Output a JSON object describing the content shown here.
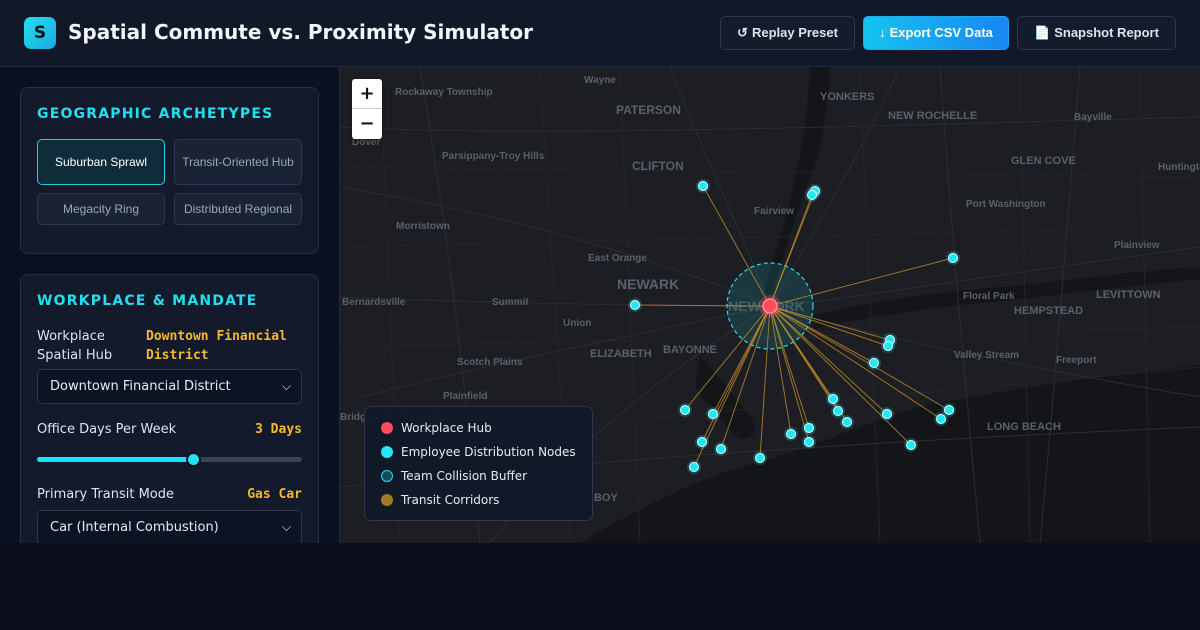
{
  "header": {
    "logo_letter": "S",
    "title": "Spatial Commute vs. Proximity Simulator",
    "replay_icon": "↺",
    "replay_label": "Replay Preset",
    "export_icon": "↓",
    "export_label": "Export CSV Data",
    "snapshot_icon": "📄",
    "snapshot_label": "Snapshot Report"
  },
  "archetypes": {
    "title": "GEOGRAPHIC ARCHETYPES",
    "items": [
      {
        "label": "Suburban Sprawl",
        "active": true
      },
      {
        "label": "Transit-Oriented Hub",
        "active": false
      },
      {
        "label": "Megacity Ring",
        "active": false
      },
      {
        "label": "Distributed Regional",
        "active": false
      }
    ]
  },
  "workplace": {
    "title": "WORKPLACE & MANDATE",
    "hub_label": "Workplace Spatial Hub",
    "hub_value": "Downtown Financial District",
    "hub_select": "Downtown Financial District",
    "days_label": "Office Days Per Week",
    "days_value": "3 Days",
    "days_fraction": 0.59,
    "transit_label": "Primary Transit Mode",
    "transit_value": "Gas Car",
    "transit_select": "Car (Internal Combustion)"
  },
  "map": {
    "zoom_in": "+",
    "zoom_out": "−",
    "place_labels": [
      "Wayne",
      "Rockaway Township",
      "PATERSON",
      "YONKERS",
      "NEW ROCHELLE",
      "Bayville",
      "Dover",
      "Parsippany-Troy Hills",
      "CLIFTON",
      "GLEN COVE",
      "Huntington Station",
      "Fairview",
      "Port Washington",
      "Morristown",
      "Plainview",
      "East Orange",
      "NEWARK",
      "NEW YORK",
      "Floral Park",
      "LEVITTOWN",
      "Bernardsville",
      "Summit",
      "HEMPSTEAD",
      "Union",
      "Scotch Plains",
      "ELIZABETH",
      "BAYONNE",
      "Valley Stream",
      "Freeport",
      "Plainfield",
      "Bridgewater Township",
      "LONG BEACH",
      "BOY"
    ]
  },
  "legend": {
    "items": [
      {
        "label": "Workplace Hub",
        "color": "#ff4b5c"
      },
      {
        "label": "Employee Distribution Nodes",
        "color": "#22e8f5"
      },
      {
        "label": "Team Collision Buffer",
        "color": "#1a5a66"
      },
      {
        "label": "Transit Corridors",
        "color": "#b08a2a"
      }
    ]
  },
  "colors": {
    "accent": "#22e0f0",
    "highlight": "#f5b92a",
    "hub": "#ff4b5c",
    "node": "#22e8f5",
    "corridor": "#c8922a"
  }
}
